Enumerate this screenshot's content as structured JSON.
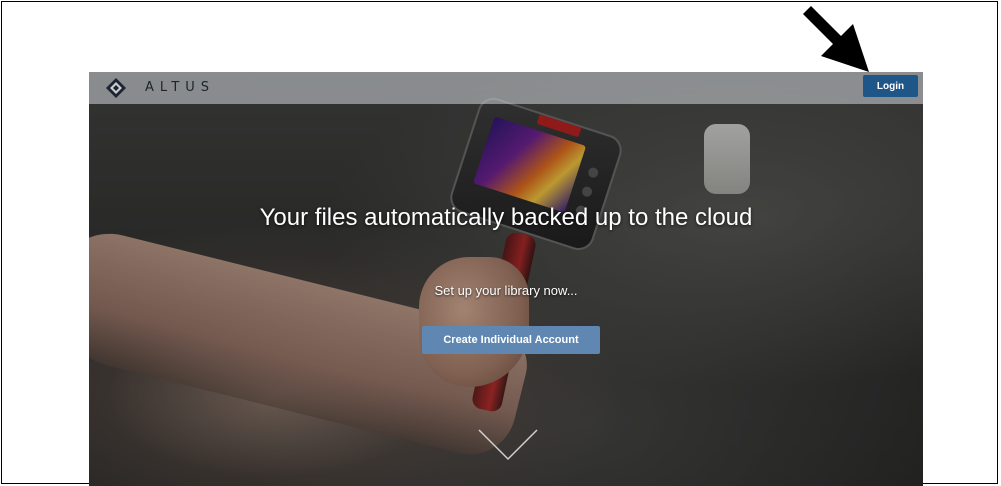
{
  "navbar": {
    "brand": "ALTUS",
    "login_label": "Login",
    "login_color": "#1f5688"
  },
  "hero": {
    "title": "Your files automatically backed up to the cloud",
    "subtitle": "Set up your library now...",
    "cta_label": "Create Individual Account",
    "cta_color": "#5f87b2"
  },
  "icons": {
    "logo": "altus-logo-icon",
    "callout": "callout-arrow-icon",
    "scroll": "chevron-down-icon"
  }
}
